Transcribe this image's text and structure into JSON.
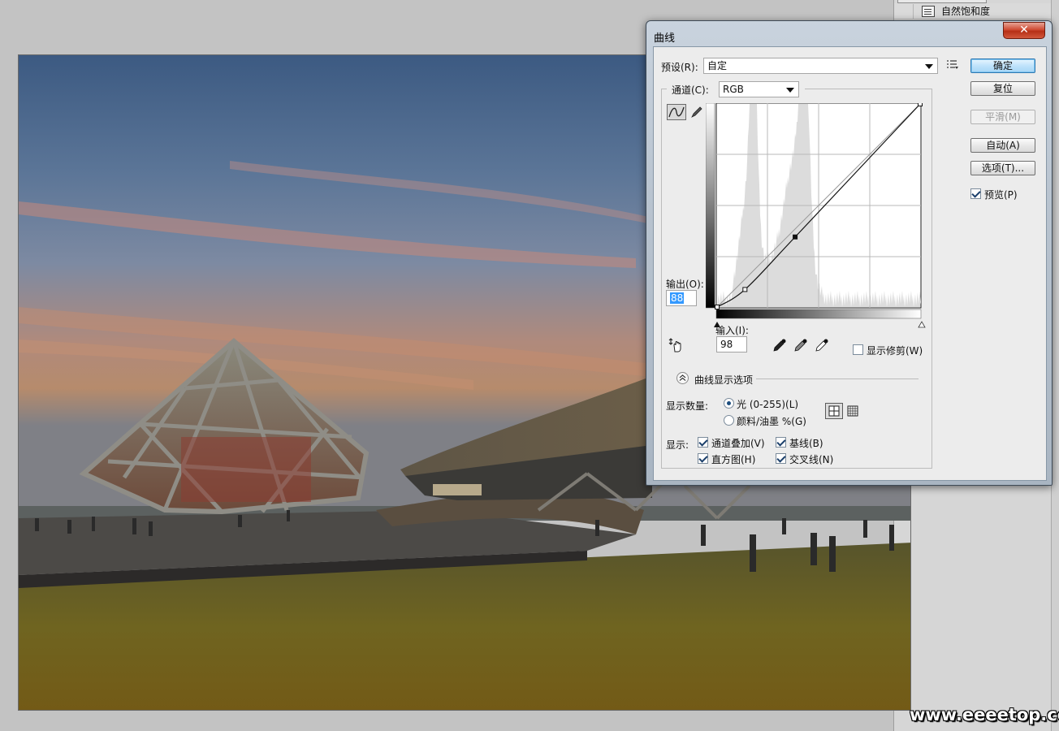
{
  "history_panel": {
    "item_label": "自然饱和度"
  },
  "watermark": "www.eeeetop.com",
  "dialog": {
    "title": "曲线",
    "close_glyph": "✕",
    "preset_label": "预设(R):",
    "preset_value": "自定",
    "channel_label": "通道(C):",
    "channel_value": "RGB",
    "output_label": "输出(O):",
    "output_value": "88",
    "input_label": "输入(I):",
    "input_value": "98",
    "show_clipping_label": "显示修剪(W)",
    "display_options_label": "曲线显示选项",
    "show_amount_label": "显示数量:",
    "light_option": "光 (0-255)(L)",
    "pigment_option": "颜料/油墨 %(G)",
    "show_label": "显示:",
    "channel_overlays": "通道叠加(V)",
    "baseline": "基线(B)",
    "histogram": "直方图(H)",
    "intersection_line": "交叉线(N)",
    "buttons": {
      "ok": "确定",
      "reset": "复位",
      "smooth": "平滑(M)",
      "auto": "自动(A)",
      "options": "选项(T)..."
    },
    "preview_label": "预览(P)"
  },
  "curve": {
    "points": [
      [
        0,
        0
      ],
      [
        35,
        22
      ],
      [
        98,
        88
      ],
      [
        255,
        255
      ]
    ]
  },
  "colors": {
    "accent": "#3399ff",
    "close": "#c8442c",
    "dialog_frame": "#b8c3cf"
  }
}
